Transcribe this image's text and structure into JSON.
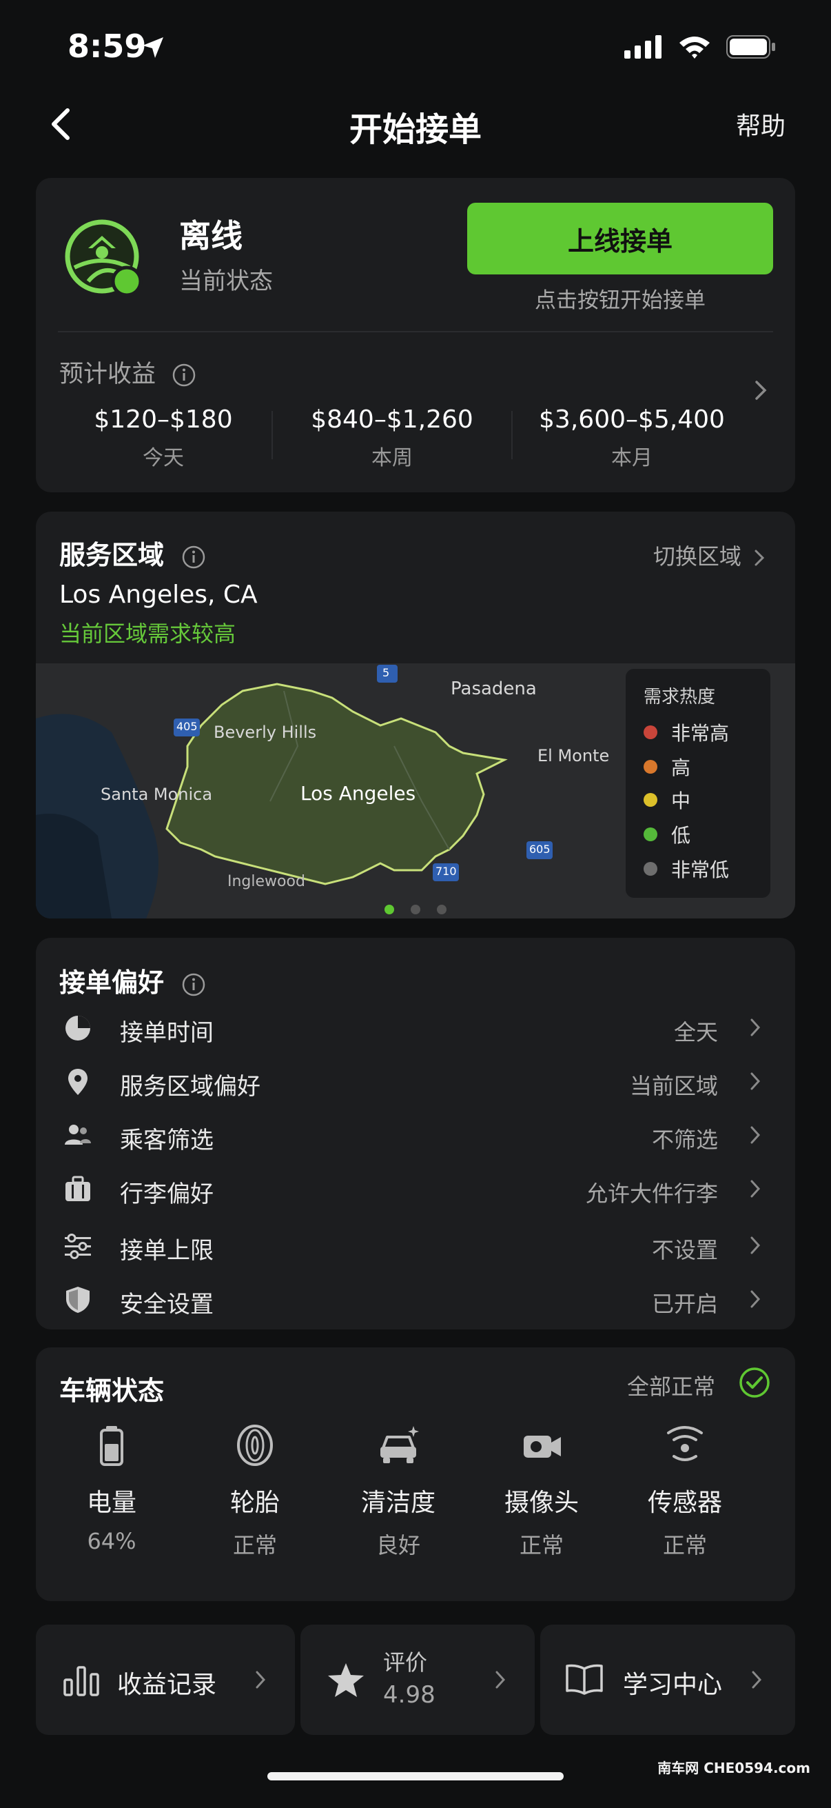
{
  "status_bar": {
    "time": "8:59"
  },
  "nav": {
    "title": "开始接单",
    "help": "帮助"
  },
  "status_card": {
    "status": "离线",
    "status_caption": "当前状态",
    "go_online_label": "上线接单",
    "go_online_hint": "点击按钮开始接单",
    "estimate_label": "预计收益",
    "estimates": [
      {
        "value": "$120–$180",
        "period": "今天"
      },
      {
        "value": "$840–$1,260",
        "period": "本周"
      },
      {
        "value": "$3,600–$5,400",
        "period": "本月"
      }
    ]
  },
  "service_area": {
    "title": "服务区域",
    "switch_label": "切换区域",
    "city": "Los Angeles, CA",
    "demand_hint": "当前区域需求较高",
    "map_labels": {
      "pasadena": "Pasadena",
      "beverly_hills": "Beverly Hills",
      "el_monte": "El Monte",
      "santa_monica": "Santa Monica",
      "los_angeles": "Los Angeles",
      "inglewood": "Inglewood",
      "hwy_5": "5",
      "hwy_405": "405",
      "hwy_605": "605",
      "hwy_710": "710"
    },
    "legend_title": "需求热度",
    "legend": [
      {
        "label": "非常高",
        "color": "#c9453a"
      },
      {
        "label": "高",
        "color": "#d9782c"
      },
      {
        "label": "中",
        "color": "#dcc02a"
      },
      {
        "label": "低",
        "color": "#55b93a"
      },
      {
        "label": "非常低",
        "color": "#6e6e6e"
      }
    ]
  },
  "preferences": {
    "title": "接单偏好",
    "items": [
      {
        "label": "接单时间",
        "value": "全天",
        "icon": "clock-icon"
      },
      {
        "label": "服务区域偏好",
        "value": "当前区域",
        "icon": "location-pin-icon"
      },
      {
        "label": "乘客筛选",
        "value": "不筛选",
        "icon": "people-icon"
      },
      {
        "label": "行李偏好",
        "value": "允许大件行李",
        "icon": "luggage-icon"
      },
      {
        "label": "接单上限",
        "value": "不设置",
        "icon": "sliders-icon"
      },
      {
        "label": "安全设置",
        "value": "已开启",
        "icon": "shield-icon"
      }
    ]
  },
  "vehicle": {
    "title": "车辆状态",
    "all_ok": "全部正常",
    "items": [
      {
        "label": "电量",
        "value": "64%",
        "icon": "battery-icon"
      },
      {
        "label": "轮胎",
        "value": "正常",
        "icon": "tire-icon"
      },
      {
        "label": "清洁度",
        "value": "良好",
        "icon": "car-clean-icon"
      },
      {
        "label": "摄像头",
        "value": "正常",
        "icon": "camera-icon"
      },
      {
        "label": "传感器",
        "value": "正常",
        "icon": "sensor-icon"
      }
    ]
  },
  "shortcuts": {
    "earnings": "收益记录",
    "rating_label": "评价",
    "rating_value": "4.98",
    "learning": "学习中心"
  },
  "watermark": "南车网 CHE0594.com",
  "colors": {
    "accent": "#5fc832",
    "card": "#1c1d1f",
    "background": "#0f1011"
  }
}
